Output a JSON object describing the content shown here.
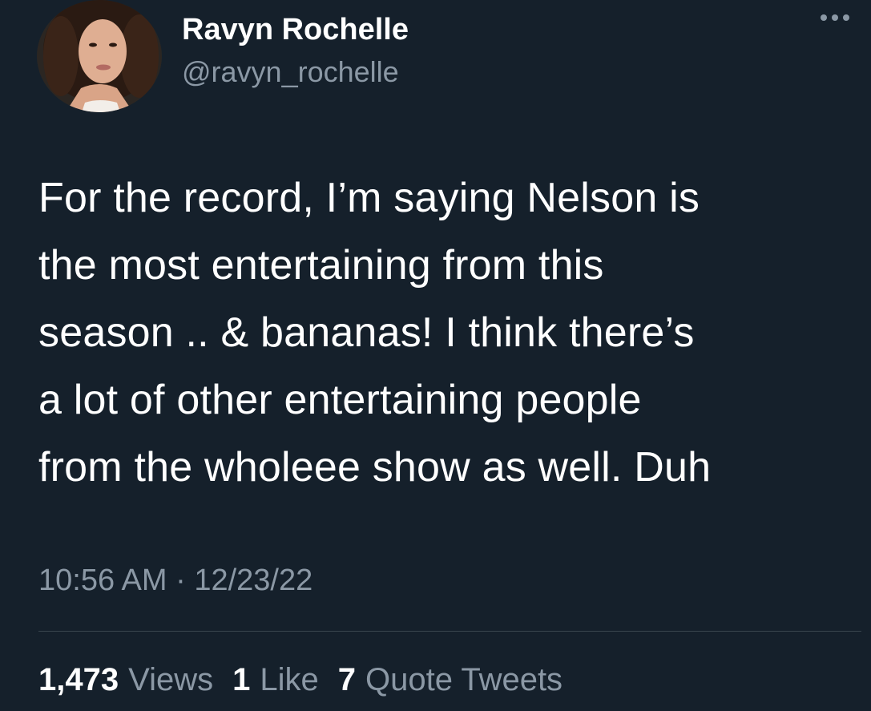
{
  "tweet": {
    "author": {
      "display_name": "Ravyn Rochelle",
      "handle": "@ravyn_rochelle",
      "avatar_icon": "profile-photo"
    },
    "more_icon": "more-options-icon",
    "text": "For the record, I’m saying Nelson is\nthe most entertaining from this\nseason .. & bananas! I think there’s\na lot of other entertaining people\nfrom the wholeee show as well. Duh",
    "time": "10:56 AM",
    "separator": "·",
    "date": "12/23/22",
    "stats": {
      "views_count": "1,473",
      "views_label": "Views",
      "likes_count": "1",
      "likes_label": "Like",
      "quotes_count": "7",
      "quotes_label": "Quote Tweets"
    }
  },
  "colors": {
    "background": "#15202b",
    "primary_text": "#ffffff",
    "secondary_text": "#8b98a5",
    "divider": "#38444d"
  }
}
